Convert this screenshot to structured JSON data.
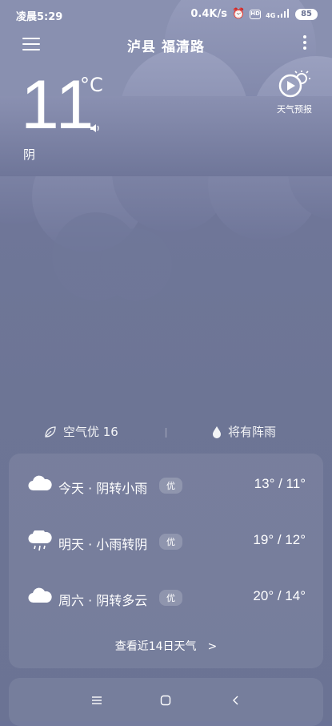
{
  "status": {
    "time": "凌晨5:29",
    "net_speed": "0.4K/s",
    "hd": "HD",
    "signal": "4G",
    "battery": "85"
  },
  "header": {
    "location": "泸县 福清路"
  },
  "current": {
    "temperature": "11",
    "unit": "°C",
    "condition": "阴"
  },
  "forecast_button": {
    "label": "天气预报"
  },
  "air": {
    "label": "空气优 16",
    "rain_label": "将有阵雨"
  },
  "daily": [
    {
      "name": "今天 · 阴转小雨",
      "badge": "优",
      "range": "13° / 11°",
      "icon": "cloud-icon"
    },
    {
      "name": "明天 · 小雨转阴",
      "badge": "优",
      "range": "19° / 12°",
      "icon": "rain-cloud-icon"
    },
    {
      "name": "周六 · 阴转多云",
      "badge": "优",
      "range": "20° / 14°",
      "icon": "cloud-icon"
    }
  ],
  "more_days": "查看近14日天气　>",
  "colors": {
    "background": "#6b7394",
    "cloud_light": "#8e93b3",
    "cloud_dark": "#5e6688"
  }
}
